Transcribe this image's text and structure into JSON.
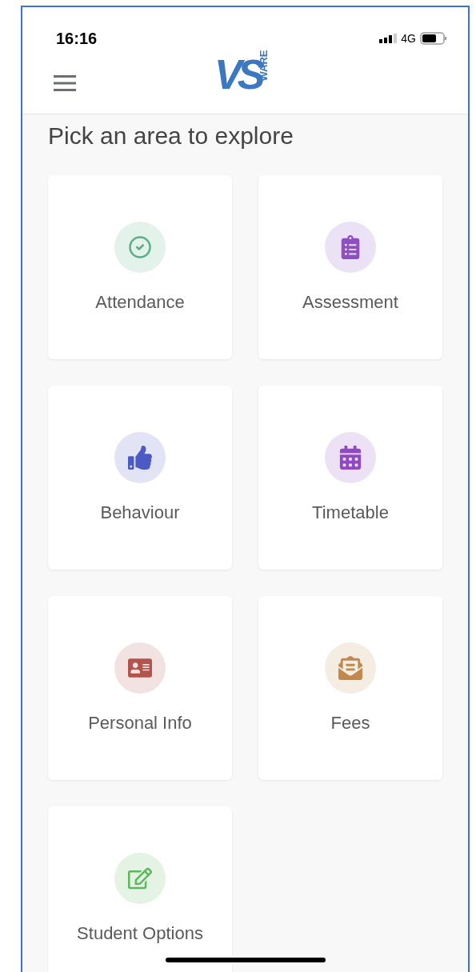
{
  "status_bar": {
    "time": "16:16",
    "network": "4G"
  },
  "header": {
    "logo": {
      "letters": "VS",
      "side_text": "WARE"
    }
  },
  "title": "Pick an area to explore",
  "tiles": [
    {
      "label": "Attendance",
      "kind": "attendance",
      "color": "#5aaf8a"
    },
    {
      "label": "Assessment",
      "kind": "assessment",
      "color": "#8e4fc0"
    },
    {
      "label": "Behaviour",
      "kind": "behaviour",
      "color": "#4c5bc4"
    },
    {
      "label": "Timetable",
      "kind": "timetable",
      "color": "#9049c2"
    },
    {
      "label": "Personal Info",
      "kind": "personal",
      "color": "#b2534c"
    },
    {
      "label": "Fees",
      "kind": "fees",
      "color": "#c08a4e"
    },
    {
      "label": "Student Options",
      "kind": "options",
      "color": "#5cb85c"
    }
  ]
}
